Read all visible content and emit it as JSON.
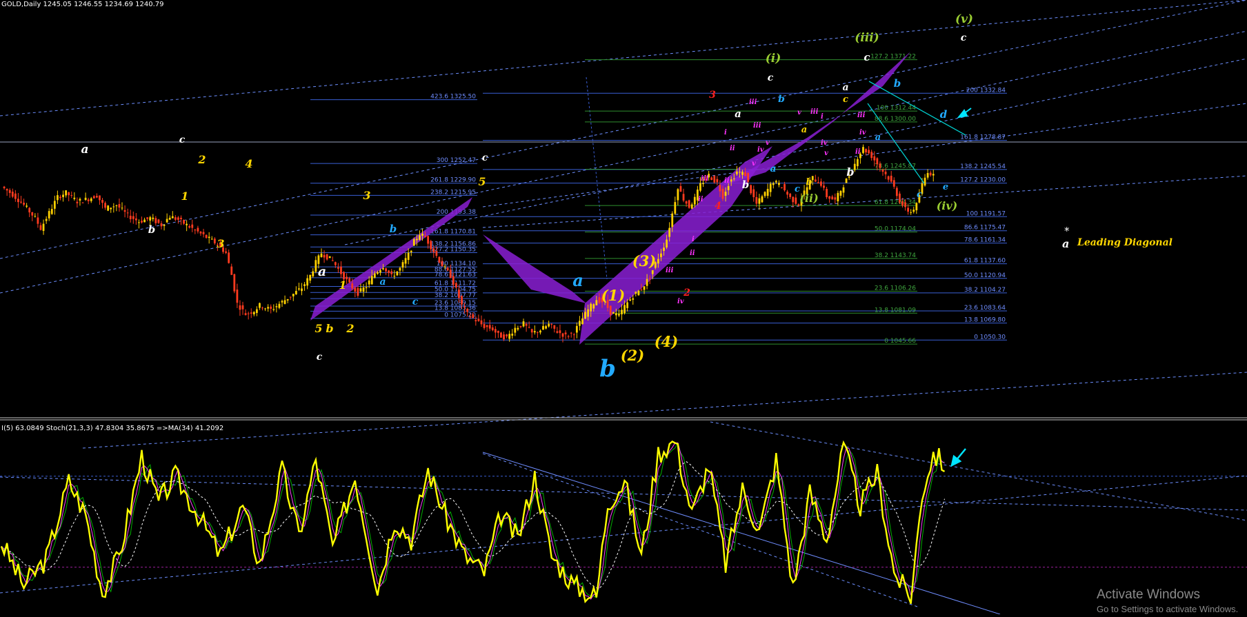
{
  "window": {
    "header": "GOLD,Daily  1245.05 1246.55 1234.69 1240.79",
    "indicator_header": "I(5) 63.0849  Stoch(21,3,3) 47.8304 35.8675  =>MA(34) 41.2092"
  },
  "legend": {
    "star": "*",
    "letter": "a",
    "label": "Leading Diagonal",
    "color": "#ffd700"
  },
  "watermark": {
    "line1": "Activate Windows",
    "line2": "Go to Settings to activate Windows."
  },
  "colors": {
    "background": "#000000",
    "fib_line": "#3a5fd6",
    "fib_green": "#2f8f2f",
    "channel": "#6d8fff",
    "bull_candle": "#ffd000",
    "bear_candle": "#ff3b1f",
    "triangle": "#8a1fd4",
    "stoch_main": "#ffff00",
    "stoch_signal": "#ff40ff",
    "stoch_green": "#00b000",
    "ma_line": "#ffffff",
    "teal": "#00cccc",
    "cyan_label": "#22aaff"
  },
  "chart_data": {
    "type": "candlestick",
    "symbol": "GOLD",
    "timeframe": "Daily",
    "price_ohlc": {
      "open": 1245.05,
      "high": 1246.55,
      "low": 1234.69,
      "close": 1240.79
    },
    "current_price_line": 1240.79,
    "price_path": [
      [
        0,
        1226
      ],
      [
        4,
        1217
      ],
      [
        8,
        1205
      ],
      [
        12,
        1190
      ],
      [
        14,
        1178
      ],
      [
        17,
        1196
      ],
      [
        20,
        1214
      ],
      [
        23,
        1219
      ],
      [
        27,
        1209
      ],
      [
        31,
        1212
      ],
      [
        34,
        1216
      ],
      [
        37,
        1201
      ],
      [
        41,
        1205
      ],
      [
        45,
        1193
      ],
      [
        49,
        1186
      ],
      [
        53,
        1190
      ],
      [
        57,
        1182
      ],
      [
        60,
        1192
      ],
      [
        63,
        1188
      ],
      [
        66,
        1182
      ],
      [
        70,
        1174
      ],
      [
        73,
        1168
      ],
      [
        77,
        1160
      ],
      [
        80,
        1150
      ],
      [
        82,
        1125
      ],
      [
        84,
        1092
      ],
      [
        87,
        1080
      ],
      [
        90,
        1084
      ],
      [
        92,
        1090
      ],
      [
        96,
        1085
      ],
      [
        100,
        1094
      ],
      [
        104,
        1103
      ],
      [
        107,
        1110
      ],
      [
        110,
        1124
      ],
      [
        112,
        1139
      ],
      [
        114,
        1150
      ],
      [
        118,
        1141
      ],
      [
        121,
        1127
      ],
      [
        124,
        1114
      ],
      [
        127,
        1104
      ],
      [
        130,
        1112
      ],
      [
        133,
        1127
      ],
      [
        136,
        1135
      ],
      [
        139,
        1123
      ],
      [
        142,
        1132
      ],
      [
        145,
        1148
      ],
      [
        147,
        1163
      ],
      [
        149,
        1172
      ],
      [
        151,
        1168
      ],
      [
        154,
        1152
      ],
      [
        157,
        1136
      ],
      [
        160,
        1124
      ],
      [
        162,
        1108
      ],
      [
        164,
        1090
      ],
      [
        166,
        1080
      ],
      [
        169,
        1073
      ],
      [
        172,
        1066
      ],
      [
        175,
        1063
      ],
      [
        177,
        1056
      ],
      [
        180,
        1053
      ],
      [
        183,
        1064
      ],
      [
        186,
        1069
      ],
      [
        189,
        1058
      ],
      [
        192,
        1062
      ],
      [
        195,
        1068
      ],
      [
        198,
        1060
      ],
      [
        201,
        1055
      ],
      [
        204,
        1059
      ],
      [
        206,
        1070
      ],
      [
        209,
        1085
      ],
      [
        212,
        1097
      ],
      [
        215,
        1093
      ],
      [
        217,
        1082
      ],
      [
        220,
        1078
      ],
      [
        222,
        1089
      ],
      [
        225,
        1101
      ],
      [
        228,
        1109
      ],
      [
        231,
        1123
      ],
      [
        233,
        1138
      ],
      [
        235,
        1151
      ],
      [
        237,
        1166
      ],
      [
        239,
        1195
      ],
      [
        241,
        1226
      ],
      [
        243,
        1212
      ],
      [
        245,
        1203
      ],
      [
        247,
        1212
      ],
      [
        249,
        1228
      ],
      [
        252,
        1239
      ],
      [
        255,
        1230
      ],
      [
        257,
        1215
      ],
      [
        259,
        1229
      ],
      [
        262,
        1243
      ],
      [
        265,
        1240
      ],
      [
        267,
        1220
      ],
      [
        269,
        1206
      ],
      [
        272,
        1218
      ],
      [
        275,
        1232
      ],
      [
        278,
        1226
      ],
      [
        281,
        1213
      ],
      [
        284,
        1206
      ],
      [
        286,
        1220
      ],
      [
        289,
        1236
      ],
      [
        292,
        1229
      ],
      [
        294,
        1215
      ],
      [
        297,
        1210
      ],
      [
        300,
        1228
      ],
      [
        303,
        1244
      ],
      [
        305,
        1260
      ],
      [
        307,
        1270
      ],
      [
        310,
        1261
      ],
      [
        313,
        1248
      ],
      [
        316,
        1236
      ],
      [
        318,
        1225
      ],
      [
        320,
        1210
      ],
      [
        322,
        1200
      ],
      [
        324,
        1197
      ],
      [
        326,
        1205
      ],
      [
        328,
        1228
      ],
      [
        330,
        1244
      ],
      [
        332,
        1238
      ]
    ],
    "fib_set_1": [
      {
        "label": "423.6",
        "value": 1325.5
      },
      {
        "label": "300",
        "value": 1252.47
      },
      {
        "label": "261.8",
        "value": 1229.9
      },
      {
        "label": "238.2",
        "value": 1215.95
      },
      {
        "label": "200",
        "value": 1193.38
      },
      {
        "label": "161.8",
        "value": 1170.81
      },
      {
        "label": "138.2",
        "value": 1156.86
      },
      {
        "label": "127.2",
        "value": 1150.35
      },
      {
        "label": "100",
        "value": 1134.1
      },
      {
        "label": "88.6",
        "value": 1127.55
      },
      {
        "label": "78.6",
        "value": 1121.63
      },
      {
        "label": "61.8",
        "value": 1111.72
      },
      {
        "label": "50.0",
        "value": 1104.75
      },
      {
        "label": "38.2",
        "value": 1097.77
      },
      {
        "label": "23.6",
        "value": 1089.15
      },
      {
        "label": "13.8",
        "value": 1083.36
      },
      {
        "label": "0",
        "value": 1075.2
      }
    ],
    "fib_set_2": [
      {
        "label": "200",
        "value": 1332.84
      },
      {
        "label": "161.8",
        "value": 1278.87
      },
      {
        "label": "138.2",
        "value": 1245.54
      },
      {
        "label": "127.2",
        "value": 1230.0
      },
      {
        "label": "100",
        "value": 1191.57
      },
      {
        "label": "86.6",
        "value": 1175.47
      },
      {
        "label": "78.6",
        "value": 1161.34
      },
      {
        "label": "61.8",
        "value": 1137.6
      },
      {
        "label": "50.0",
        "value": 1120.94
      },
      {
        "label": "38.2",
        "value": 1104.27
      },
      {
        "label": "23.6",
        "value": 1083.64
      },
      {
        "label": "13.8",
        "value": 1069.8
      },
      {
        "label": "0",
        "value": 1050.3
      }
    ],
    "fib_set_3": [
      {
        "label": "127.2",
        "value": 1371.22
      },
      {
        "label": "100",
        "value": 1312.44
      },
      {
        "label": "88.6",
        "value": 1300.0
      },
      {
        "label": "78.6",
        "value": 1245.87
      },
      {
        "label": "61.8",
        "value": 1204.34
      },
      {
        "label": "50.0",
        "value": 1174.04
      },
      {
        "label": "38.2",
        "value": 1143.74
      },
      {
        "label": "23.6",
        "value": 1106.26
      },
      {
        "label": "13.8",
        "value": 1081.09
      },
      {
        "label": "0",
        "value": 1045.66
      }
    ],
    "stochastic": {
      "main": 47.8304,
      "signal": 35.8675,
      "ma34": 41.2092,
      "i5": 63.0849,
      "series": [
        [
          0,
          38
        ],
        [
          8,
          12
        ],
        [
          16,
          28
        ],
        [
          24,
          75
        ],
        [
          30,
          55
        ],
        [
          36,
          8
        ],
        [
          42,
          30
        ],
        [
          50,
          90
        ],
        [
          56,
          62
        ],
        [
          62,
          78
        ],
        [
          70,
          55
        ],
        [
          78,
          30
        ],
        [
          86,
          60
        ],
        [
          92,
          25
        ],
        [
          100,
          82
        ],
        [
          106,
          42
        ],
        [
          112,
          88
        ],
        [
          118,
          35
        ],
        [
          126,
          78
        ],
        [
          134,
          10
        ],
        [
          140,
          52
        ],
        [
          146,
          40
        ],
        [
          152,
          82
        ],
        [
          158,
          55
        ],
        [
          165,
          30
        ],
        [
          172,
          20
        ],
        [
          178,
          55
        ],
        [
          184,
          40
        ],
        [
          190,
          78
        ],
        [
          196,
          30
        ],
        [
          204,
          12
        ],
        [
          212,
          5
        ],
        [
          216,
          62
        ],
        [
          222,
          75
        ],
        [
          228,
          30
        ],
        [
          234,
          92
        ],
        [
          240,
          100
        ],
        [
          246,
          55
        ],
        [
          252,
          85
        ],
        [
          258,
          25
        ],
        [
          264,
          70
        ],
        [
          270,
          45
        ],
        [
          276,
          88
        ],
        [
          282,
          10
        ],
        [
          288,
          68
        ],
        [
          294,
          40
        ],
        [
          300,
          96
        ],
        [
          306,
          60
        ],
        [
          312,
          80
        ],
        [
          318,
          20
        ],
        [
          324,
          4
        ],
        [
          328,
          68
        ],
        [
          332,
          92
        ],
        [
          336,
          85
        ]
      ]
    }
  },
  "labels": [
    {
      "text": "a",
      "x": 123,
      "y": 222,
      "color": "#ffffff",
      "size": 17
    },
    {
      "text": "c",
      "x": 264,
      "y": 207,
      "color": "#ffffff",
      "size": 14
    },
    {
      "text": "2",
      "x": 293,
      "y": 237,
      "color": "#ffd700",
      "size": 16
    },
    {
      "text": "4",
      "x": 361,
      "y": 243,
      "color": "#ffd700",
      "size": 16
    },
    {
      "text": "1",
      "x": 268,
      "y": 290,
      "color": "#ffd700",
      "size": 16
    },
    {
      "text": "b",
      "x": 220,
      "y": 338,
      "color": "#ffffff",
      "size": 15
    },
    {
      "text": "3",
      "x": 320,
      "y": 359,
      "color": "#ffd700",
      "size": 16
    },
    {
      "text": "3",
      "x": 532,
      "y": 289,
      "color": "#ffd700",
      "size": 16
    },
    {
      "text": "a",
      "x": 467,
      "y": 400,
      "color": "#ffffff",
      "size": 19
    },
    {
      "text": "1",
      "x": 497,
      "y": 419,
      "color": "#ffd700",
      "size": 16
    },
    {
      "text": "b",
      "x": 570,
      "y": 337,
      "color": "#22aaff",
      "size": 15
    },
    {
      "text": "a",
      "x": 555,
      "y": 413,
      "color": "#22aaff",
      "size": 14
    },
    {
      "text": "c",
      "x": 602,
      "y": 442,
      "color": "#22aaff",
      "size": 14
    },
    {
      "text": "5",
      "x": 462,
      "y": 482,
      "color": "#ffd700",
      "size": 16
    },
    {
      "text": "b",
      "x": 478,
      "y": 482,
      "color": "#ffd700",
      "size": 16
    },
    {
      "text": "2",
      "x": 508,
      "y": 482,
      "color": "#ffd700",
      "size": 16
    },
    {
      "text": "c",
      "x": 463,
      "y": 522,
      "color": "#ffffff",
      "size": 14
    },
    {
      "text": "c",
      "x": 703,
      "y": 233,
      "color": "#ffffff",
      "size": 14
    },
    {
      "text": "5",
      "x": 699,
      "y": 269,
      "color": "#ffd700",
      "size": 16
    },
    {
      "text": "a",
      "x": 838,
      "y": 415,
      "color": "#22aaff",
      "size": 24
    },
    {
      "text": "b",
      "x": 881,
      "y": 546,
      "color": "#22aaff",
      "size": 34
    },
    {
      "text": "(1)",
      "x": 889,
      "y": 436,
      "color": "#ffd700",
      "size": 21
    },
    {
      "text": "(2)",
      "x": 917,
      "y": 523,
      "color": "#ffd700",
      "size": 21
    },
    {
      "text": "(3)",
      "x": 934,
      "y": 386,
      "color": "#ffd700",
      "size": 21
    },
    {
      "text": "(4)",
      "x": 966,
      "y": 503,
      "color": "#ffd700",
      "size": 21
    },
    {
      "text": "3",
      "x": 1033,
      "y": 142,
      "color": "#ff2020",
      "size": 14
    },
    {
      "text": "a",
      "x": 1070,
      "y": 170,
      "color": "#ffffff",
      "size": 15
    },
    {
      "text": "4",
      "x": 1041,
      "y": 303,
      "color": "#ff2020",
      "size": 14
    },
    {
      "text": "2",
      "x": 996,
      "y": 429,
      "color": "#ff2020",
      "size": 14
    },
    {
      "text": "b",
      "x": 1081,
      "y": 273,
      "color": "#ffffff",
      "size": 15
    },
    {
      "text": "(i)",
      "x": 1121,
      "y": 90,
      "color": "#9acd32",
      "size": 17
    },
    {
      "text": "c",
      "x": 1117,
      "y": 117,
      "color": "#ffffff",
      "size": 14
    },
    {
      "text": "b",
      "x": 1133,
      "y": 148,
      "color": "#22aaff",
      "size": 14
    },
    {
      "text": "a",
      "x": 1121,
      "y": 249,
      "color": "#22aaff",
      "size": 14
    },
    {
      "text": "a",
      "x": 1166,
      "y": 192,
      "color": "#ffd700",
      "size": 13
    },
    {
      "text": "c",
      "x": 1156,
      "y": 278,
      "color": "#22aaff",
      "size": 13
    },
    {
      "text": "b",
      "x": 1173,
      "y": 268,
      "color": "#ffd700",
      "size": 13
    },
    {
      "text": "(ii)",
      "x": 1173,
      "y": 293,
      "color": "#9acd32",
      "size": 16
    },
    {
      "text": "(iii)",
      "x": 1257,
      "y": 60,
      "color": "#9acd32",
      "size": 17
    },
    {
      "text": "c",
      "x": 1257,
      "y": 88,
      "color": "#ffffff",
      "size": 15
    },
    {
      "text": "a",
      "x": 1226,
      "y": 131,
      "color": "#ffffff",
      "size": 14
    },
    {
      "text": "c",
      "x": 1226,
      "y": 148,
      "color": "#ffd700",
      "size": 13
    },
    {
      "text": "b",
      "x": 1301,
      "y": 126,
      "color": "#22aaff",
      "size": 15
    },
    {
      "text": "a",
      "x": 1273,
      "y": 203,
      "color": "#22aaff",
      "size": 13
    },
    {
      "text": "b",
      "x": 1233,
      "y": 255,
      "color": "#ffffff",
      "size": 16
    },
    {
      "text": "(v)",
      "x": 1398,
      "y": 33,
      "color": "#9acd32",
      "size": 17
    },
    {
      "text": "c",
      "x": 1397,
      "y": 59,
      "color": "#ffffff",
      "size": 14
    },
    {
      "text": "d",
      "x": 1368,
      "y": 171,
      "color": "#22aaff",
      "size": 15
    },
    {
      "text": "c",
      "x": 1333,
      "y": 286,
      "color": "#22aaff",
      "size": 13
    },
    {
      "text": "e",
      "x": 1371,
      "y": 275,
      "color": "#22aaff",
      "size": 13
    },
    {
      "text": "(iv)",
      "x": 1373,
      "y": 304,
      "color": "#9acd32",
      "size": 16
    }
  ]
}
